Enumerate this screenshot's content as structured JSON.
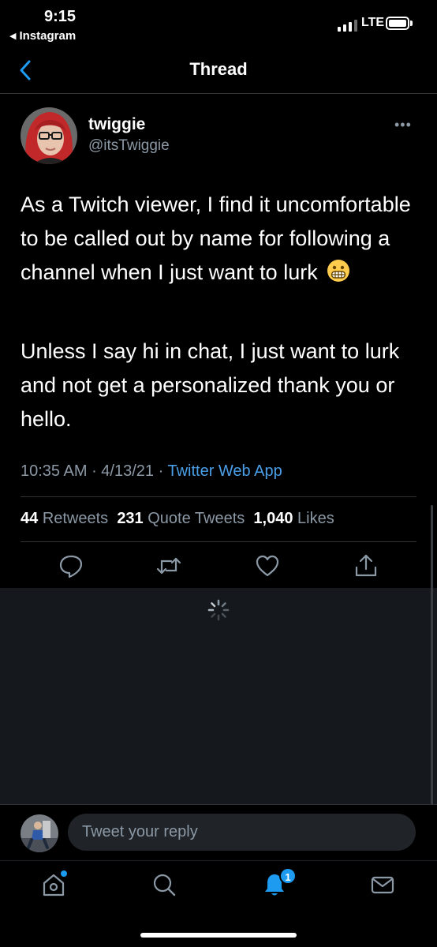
{
  "status_bar": {
    "time": "9:15",
    "back_app": "Instagram",
    "network": "LTE"
  },
  "header": {
    "title": "Thread"
  },
  "tweet": {
    "display_name": "twiggie",
    "handle": "@itsTwiggie",
    "text_paragraph_1": "As a Twitch viewer, I find it uncomfortable to be called out by name for following a channel when I just want to lurk",
    "emoji": "grimacing-face",
    "text_paragraph_2": "Unless I say hi in chat, I just want to lurk and not get a personalized thank you or hello.",
    "time": "10:35 AM",
    "date": "4/13/21",
    "source": "Twitter Web App",
    "stats": {
      "retweets_count": "44",
      "retweets_label": "Retweets",
      "quotes_count": "231",
      "quotes_label": "Quote Tweets",
      "likes_count": "1,040",
      "likes_label": "Likes"
    }
  },
  "reply": {
    "placeholder": "Tweet your reply"
  },
  "tab_bar": {
    "notifications_badge": "1"
  },
  "icons": {
    "back": "chevron-left-icon",
    "more": "more-horizontal-icon",
    "reply": "comment-icon",
    "retweet": "retweet-icon",
    "like": "heart-icon",
    "share": "share-icon",
    "home": "home-icon",
    "search": "search-icon",
    "notifications": "bell-icon",
    "messages": "mail-icon"
  },
  "colors": {
    "accent": "#1d9bf0",
    "link": "#4a9fe8",
    "secondary_text": "#8b98a5",
    "background": "#000000"
  }
}
